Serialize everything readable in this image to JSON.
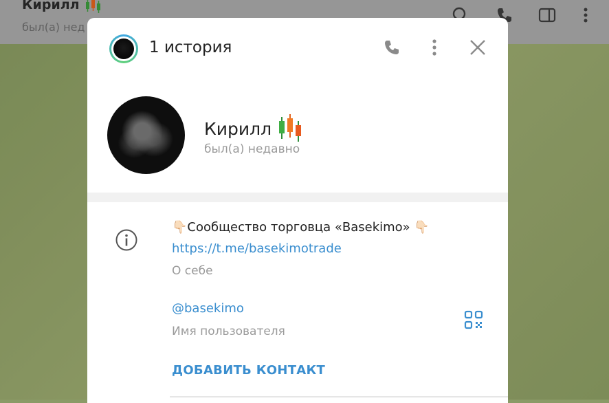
{
  "chat_header": {
    "name": "Кирилл",
    "status": "был(а) нед"
  },
  "modal": {
    "stories_title": "1 история",
    "profile": {
      "name": "Кирилл",
      "status": "был(а) недавно"
    },
    "bio": {
      "text": "👇🏻Сообщество торговца «Basekimo» 👇🏻",
      "link": "https://t.me/basekimotrade",
      "label": "О себе"
    },
    "username": {
      "value": "@basekimo",
      "label": "Имя пользователя"
    },
    "add_contact_label": "ДОБАВИТЬ КОНТАКТ"
  },
  "icons": {
    "header": [
      "search-icon",
      "phone-icon",
      "sidebar-toggle-icon",
      "more-vertical-icon"
    ],
    "modal": [
      "phone-icon",
      "more-vertical-icon",
      "close-icon",
      "info-icon",
      "qr-code-icon",
      "candlestick-emoji-icon"
    ]
  },
  "colors": {
    "accent": "#3a8ecf",
    "muted": "#9a9a9a",
    "story_ring": "#40a7e3"
  }
}
